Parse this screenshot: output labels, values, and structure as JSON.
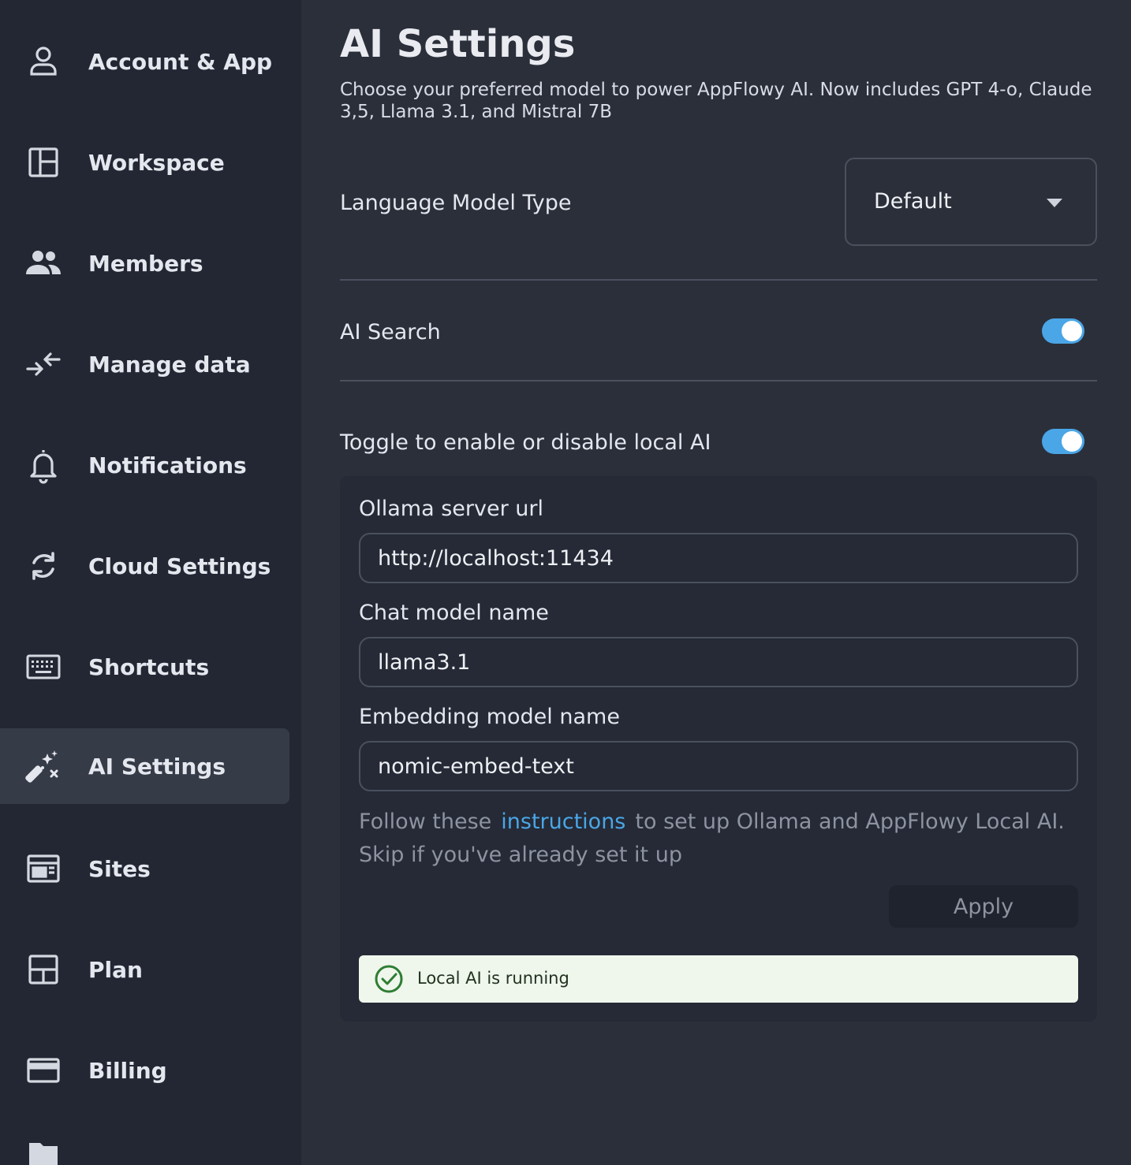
{
  "sidebar": {
    "items": [
      {
        "label": "Account & App",
        "icon": "person-icon"
      },
      {
        "label": "Workspace",
        "icon": "workspace-icon"
      },
      {
        "label": "Members",
        "icon": "members-icon"
      },
      {
        "label": "Manage data",
        "icon": "compress-arrows-icon"
      },
      {
        "label": "Notifications",
        "icon": "bell-icon"
      },
      {
        "label": "Cloud Settings",
        "icon": "sync-icon"
      },
      {
        "label": "Shortcuts",
        "icon": "keyboard-icon"
      },
      {
        "label": "AI Settings",
        "icon": "magic-wand-icon"
      },
      {
        "label": "Sites",
        "icon": "sites-icon"
      },
      {
        "label": "Plan",
        "icon": "plan-icon"
      },
      {
        "label": "Billing",
        "icon": "card-icon"
      }
    ],
    "active_index": 7
  },
  "main": {
    "title": "AI Settings",
    "description": "Choose your preferred model to power AppFlowy AI. Now includes GPT 4-o, Claude 3,5, Llama 3.1, and Mistral 7B",
    "language_model": {
      "label": "Language Model Type",
      "selected": "Default"
    },
    "ai_search": {
      "label": "AI Search",
      "enabled": true
    },
    "local_ai": {
      "label": "Toggle to enable or disable local AI",
      "enabled": true,
      "ollama_url": {
        "label": "Ollama server url",
        "value": "http://localhost:11434"
      },
      "chat_model": {
        "label": "Chat model name",
        "value": "llama3.1"
      },
      "embedding_model": {
        "label": "Embedding model name",
        "value": "nomic-embed-text"
      },
      "help_prefix": "Follow these",
      "help_link": "instructions",
      "help_suffix": "to set up Ollama and AppFlowy Local AI. Skip if you've already set it up",
      "apply_label": "Apply",
      "status_text": "Local AI is running"
    }
  },
  "colors": {
    "accent": "#4aa6e6",
    "status_bg": "#eff6ec",
    "status_icon": "#2e7d32"
  }
}
